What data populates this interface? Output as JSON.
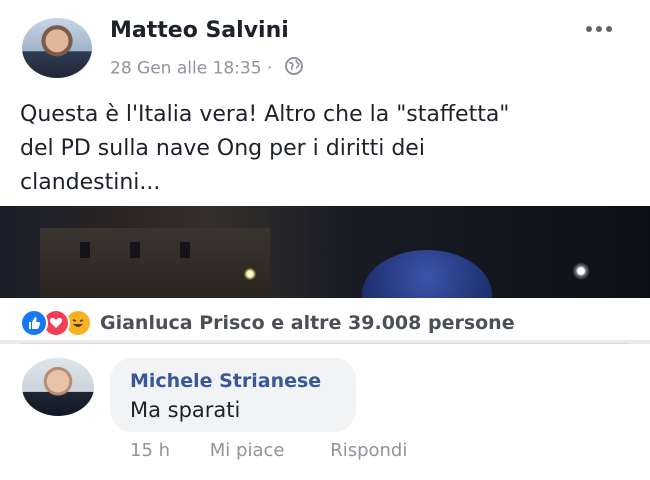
{
  "post": {
    "author": "Matteo Salvini",
    "timestamp": "28 Gen alle 18:35 ·",
    "privacy_icon": "globe-icon",
    "more_icon": "more-options-icon",
    "text_lines": [
      "Questa è l'Italia vera! Altro che la \"staffetta\"",
      "del PD sulla nave Ong per i diritti dei",
      "clandestini..."
    ]
  },
  "reactions": {
    "icons": [
      "like-icon",
      "love-icon",
      "haha-icon"
    ],
    "summary": "Gianluca Prisco e altre 39.008 persone"
  },
  "comment": {
    "author": "Michele Strianese",
    "text": "Ma sparati",
    "time": "15 h",
    "like_label": "Mi piace",
    "reply_label": "Rispondi"
  },
  "colors": {
    "link": "#385898",
    "meta": "#90949c",
    "like": "#1877f2",
    "love": "#f33e58",
    "haha": "#f7b125"
  }
}
